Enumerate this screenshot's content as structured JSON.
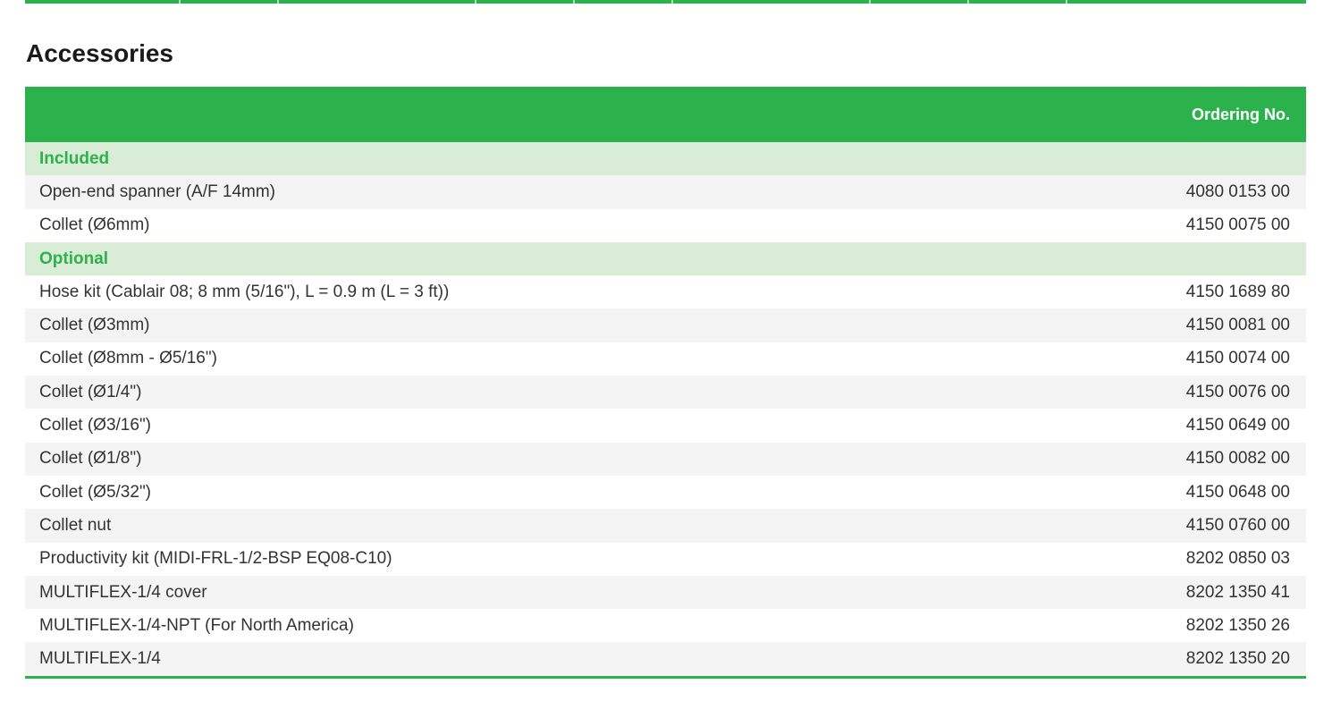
{
  "section": {
    "title": "Accessories"
  },
  "table": {
    "header": {
      "ordering_no": "Ordering No."
    },
    "groups": [
      {
        "label": "Included",
        "rows": [
          {
            "desc": "Open-end spanner (A/F 14mm)",
            "no": "4080 0153 00"
          },
          {
            "desc": "Collet (Ø6mm)",
            "no": "4150 0075 00"
          }
        ]
      },
      {
        "label": "Optional",
        "rows": [
          {
            "desc": "Hose kit (Cablair 08; 8 mm (5/16\"), L = 0.9 m (L = 3 ft))",
            "no": "4150 1689 80"
          },
          {
            "desc": "Collet (Ø3mm)",
            "no": "4150 0081 00"
          },
          {
            "desc": "Collet (Ø8mm - Ø5/16\")",
            "no": "4150 0074 00"
          },
          {
            "desc": "Collet (Ø1/4\")",
            "no": "4150 0076 00"
          },
          {
            "desc": "Collet (Ø3/16\")",
            "no": "4150 0649 00"
          },
          {
            "desc": "Collet (Ø1/8\")",
            "no": "4150 0082 00"
          },
          {
            "desc": "Collet (Ø5/32\")",
            "no": "4150 0648 00"
          },
          {
            "desc": "Collet nut",
            "no": "4150 0760 00"
          },
          {
            "desc": "Productivity kit (MIDI-FRL-1/2-BSP EQ08-C10)",
            "no": "8202 0850 03"
          },
          {
            "desc": "MULTIFLEX-1/4 cover",
            "no": "8202 1350 41"
          },
          {
            "desc": "MULTIFLEX-1/4-NPT (For North America)",
            "no": "8202 1350 26"
          },
          {
            "desc": "MULTIFLEX-1/4",
            "no": "8202 1350 20"
          }
        ]
      }
    ]
  },
  "colors": {
    "accent": "#2bb24c",
    "group_bg": "#d9ecd6",
    "row_shade": "#f4f4f4"
  }
}
